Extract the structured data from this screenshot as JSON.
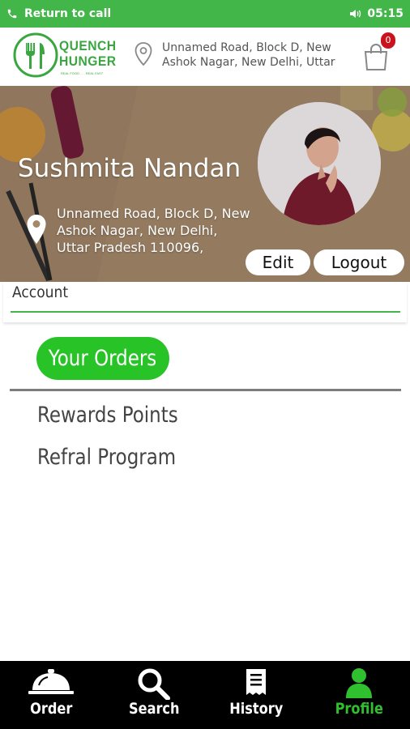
{
  "status_bar": {
    "call_text": "Return to call",
    "time": "05:15"
  },
  "header": {
    "logo_line1": "QUENCH",
    "logo_line2": "HUNGER",
    "logo_tagline": "REAL FOOD . . . REAL FAST",
    "address": "Unnamed Road, Block D, New Ashok Nagar, New Delhi, Uttar",
    "cart_count": "0"
  },
  "profile": {
    "name": "Sushmita Nandan",
    "address": "Unnamed Road, Block D, New Ashok Nagar, New Delhi, Uttar Pradesh 110096,",
    "edit_label": "Edit",
    "logout_label": "Logout"
  },
  "account": {
    "title": "Account",
    "orders_label": "Your Orders",
    "menu": [
      "Rewards Points",
      "Refral Program"
    ]
  },
  "bottom_nav": {
    "items": [
      {
        "label": "Order",
        "icon": "cloche-icon"
      },
      {
        "label": "Search",
        "icon": "search-icon"
      },
      {
        "label": "History",
        "icon": "receipt-icon"
      },
      {
        "label": "Profile",
        "icon": "user-icon"
      }
    ],
    "active_index": 3
  },
  "colors": {
    "brand_green": "#43b649",
    "active_green": "#2fbf2f",
    "badge_red": "#c8141e"
  }
}
